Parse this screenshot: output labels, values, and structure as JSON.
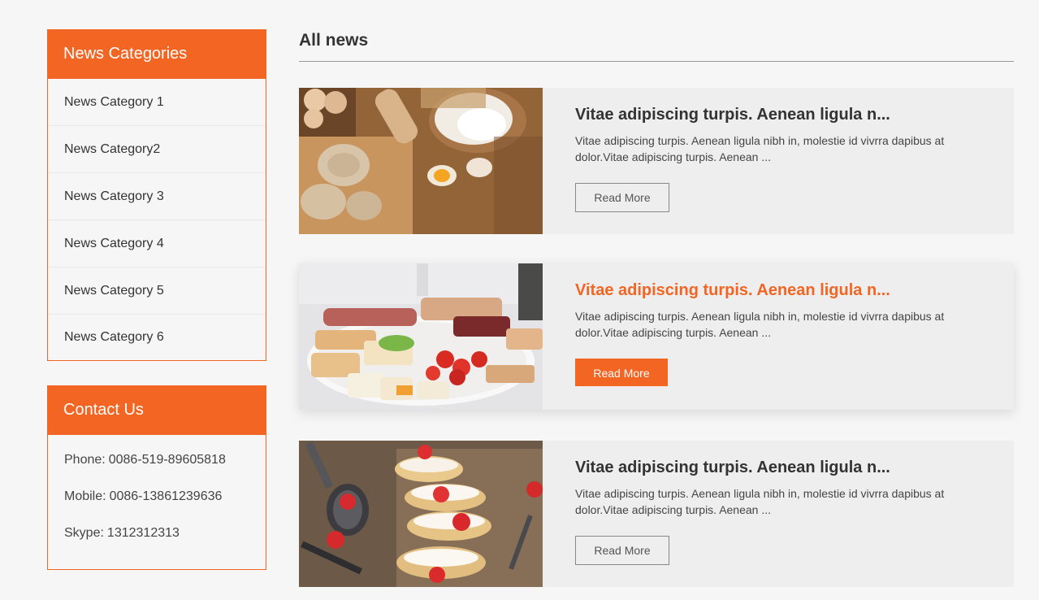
{
  "sidebar": {
    "categories": {
      "title": "News Categories",
      "items": [
        "News Category 1",
        "News Category2",
        "News Category 3",
        "News Category 4",
        "News Category 5",
        "News Category 6"
      ]
    },
    "contact": {
      "title": "Contact Us",
      "phone_label": "Phone:",
      "phone": "0086-519-89605818",
      "mobile_label": "Mobile:",
      "mobile": "0086-13861239636",
      "skype_label": "Skype:",
      "skype": "1312312313"
    }
  },
  "main": {
    "title": "All news",
    "news": [
      {
        "title": "Vitae adipiscing turpis. Aenean ligula n...",
        "excerpt": "Vitae adipiscing turpis. Aenean ligula nibh in, molestie id vivrra dapibus at dolor.Vitae adipiscing turpis. Aenean ...",
        "read_more": "Read More",
        "image": "pasta-flour-eggs-photo"
      },
      {
        "title": "Vitae adipiscing turpis. Aenean ligula n...",
        "excerpt": "Vitae adipiscing turpis. Aenean ligula nibh in, molestie id vivrra dapibus at dolor.Vitae adipiscing turpis. Aenean ...",
        "read_more": "Read More",
        "image": "charcuterie-platter-photo"
      },
      {
        "title": "Vitae adipiscing turpis. Aenean ligula n...",
        "excerpt": "Vitae adipiscing turpis. Aenean ligula nibh in, molestie id vivrra dapibus at dolor.Vitae adipiscing turpis. Aenean ...",
        "read_more": "Read More",
        "image": "strawberry-eclairs-photo"
      }
    ]
  },
  "colors": {
    "accent": "#f26522",
    "background": "#f6f6f6",
    "card": "#efeeee"
  }
}
